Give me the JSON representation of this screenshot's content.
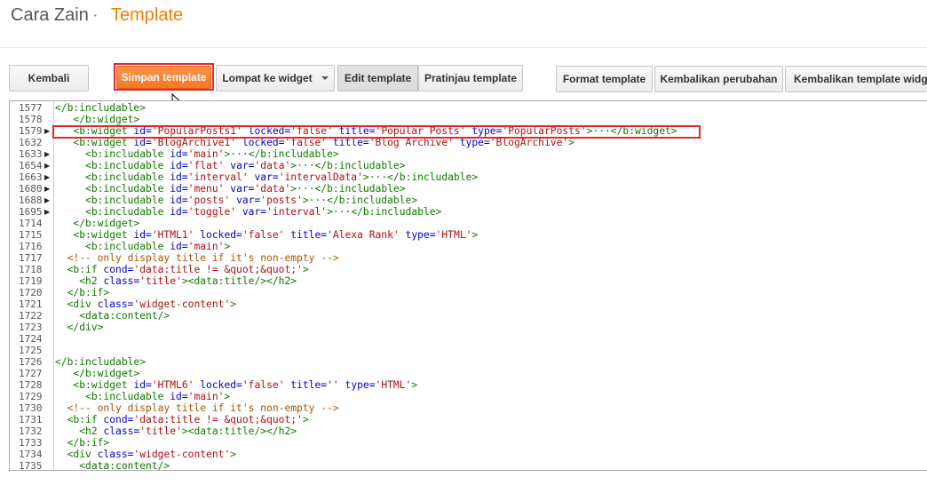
{
  "header": {
    "blog_name": "Cara Zain",
    "separator": "·",
    "page_title": "Template",
    "title_color": "#f57d00"
  },
  "toolbar": {
    "back": "Kembali",
    "save": "Simpan template",
    "jump_widget": "Lompat ke widget",
    "edit": "Edit template",
    "preview": "Pratinjau template",
    "format": "Format template",
    "revert": "Kembalikan perubahan",
    "revert_widgets": "Kembalikan template widget"
  },
  "editor": {
    "lines": [
      {
        "n": "1577",
        "fold": false,
        "tokens": [
          [
            "t",
            "</b:includable>"
          ]
        ]
      },
      {
        "n": "1578",
        "fold": false,
        "tokens": [
          [
            "p",
            "   "
          ],
          [
            "t",
            "</b:widget>"
          ]
        ]
      },
      {
        "n": "1579",
        "fold": true,
        "tokens": [
          [
            "p",
            "   "
          ],
          [
            "t",
            "<b:widget "
          ],
          [
            "a",
            "id="
          ],
          [
            "s",
            "'PopularPosts1'"
          ],
          [
            "p",
            " "
          ],
          [
            "a",
            "locked="
          ],
          [
            "s",
            "'false'"
          ],
          [
            "p",
            " "
          ],
          [
            "a",
            "title="
          ],
          [
            "s",
            "'Popular Posts'"
          ],
          [
            "p",
            " "
          ],
          [
            "a",
            "type="
          ],
          [
            "s",
            "'PopularPosts'"
          ],
          [
            "t",
            ">···</b:widget>"
          ]
        ]
      },
      {
        "n": "1632",
        "fold": false,
        "tokens": [
          [
            "p",
            "   "
          ],
          [
            "t",
            "<b:widget "
          ],
          [
            "a",
            "id="
          ],
          [
            "s",
            "'BlogArchive1'"
          ],
          [
            "p",
            " "
          ],
          [
            "a",
            "locked="
          ],
          [
            "s",
            "'false'"
          ],
          [
            "p",
            " "
          ],
          [
            "a",
            "title="
          ],
          [
            "s",
            "'Blog Archive'"
          ],
          [
            "p",
            " "
          ],
          [
            "a",
            "type="
          ],
          [
            "s",
            "'BlogArchive'"
          ],
          [
            "t",
            ">"
          ]
        ]
      },
      {
        "n": "1633",
        "fold": true,
        "tokens": [
          [
            "p",
            "     "
          ],
          [
            "t",
            "<b:includable "
          ],
          [
            "a",
            "id="
          ],
          [
            "s",
            "'main'"
          ],
          [
            "t",
            ">···</b:includable>"
          ]
        ]
      },
      {
        "n": "1654",
        "fold": true,
        "tokens": [
          [
            "p",
            "     "
          ],
          [
            "t",
            "<b:includable "
          ],
          [
            "a",
            "id="
          ],
          [
            "s",
            "'flat'"
          ],
          [
            "p",
            " "
          ],
          [
            "a",
            "var="
          ],
          [
            "s",
            "'data'"
          ],
          [
            "t",
            ">···</b:includable>"
          ]
        ]
      },
      {
        "n": "1663",
        "fold": true,
        "tokens": [
          [
            "p",
            "     "
          ],
          [
            "t",
            "<b:includable "
          ],
          [
            "a",
            "id="
          ],
          [
            "s",
            "'interval'"
          ],
          [
            "p",
            " "
          ],
          [
            "a",
            "var="
          ],
          [
            "s",
            "'intervalData'"
          ],
          [
            "t",
            ">···</b:includable>"
          ]
        ]
      },
      {
        "n": "1680",
        "fold": true,
        "tokens": [
          [
            "p",
            "     "
          ],
          [
            "t",
            "<b:includable "
          ],
          [
            "a",
            "id="
          ],
          [
            "s",
            "'menu'"
          ],
          [
            "p",
            " "
          ],
          [
            "a",
            "var="
          ],
          [
            "s",
            "'data'"
          ],
          [
            "t",
            ">···</b:includable>"
          ]
        ]
      },
      {
        "n": "1688",
        "fold": true,
        "tokens": [
          [
            "p",
            "     "
          ],
          [
            "t",
            "<b:includable "
          ],
          [
            "a",
            "id="
          ],
          [
            "s",
            "'posts'"
          ],
          [
            "p",
            " "
          ],
          [
            "a",
            "var="
          ],
          [
            "s",
            "'posts'"
          ],
          [
            "t",
            ">···</b:includable>"
          ]
        ]
      },
      {
        "n": "1695",
        "fold": true,
        "tokens": [
          [
            "p",
            "     "
          ],
          [
            "t",
            "<b:includable "
          ],
          [
            "a",
            "id="
          ],
          [
            "s",
            "'toggle'"
          ],
          [
            "p",
            " "
          ],
          [
            "a",
            "var="
          ],
          [
            "s",
            "'interval'"
          ],
          [
            "t",
            ">···</b:includable>"
          ]
        ]
      },
      {
        "n": "1714",
        "fold": false,
        "tokens": [
          [
            "p",
            "   "
          ],
          [
            "t",
            "</b:widget>"
          ]
        ]
      },
      {
        "n": "1715",
        "fold": false,
        "tokens": [
          [
            "p",
            "   "
          ],
          [
            "t",
            "<b:widget "
          ],
          [
            "a",
            "id="
          ],
          [
            "s",
            "'HTML1'"
          ],
          [
            "p",
            " "
          ],
          [
            "a",
            "locked="
          ],
          [
            "s",
            "'false'"
          ],
          [
            "p",
            " "
          ],
          [
            "a",
            "title="
          ],
          [
            "s",
            "'Alexa Rank'"
          ],
          [
            "p",
            " "
          ],
          [
            "a",
            "type="
          ],
          [
            "s",
            "'HTML'"
          ],
          [
            "t",
            ">"
          ]
        ]
      },
      {
        "n": "1716",
        "fold": false,
        "tokens": [
          [
            "p",
            "     "
          ],
          [
            "t",
            "<b:includable "
          ],
          [
            "a",
            "id="
          ],
          [
            "s",
            "'main'"
          ],
          [
            "t",
            ">"
          ]
        ]
      },
      {
        "n": "1717",
        "fold": false,
        "tokens": [
          [
            "p",
            "  "
          ],
          [
            "c",
            "<!-- only display title if it's non-empty -->"
          ]
        ]
      },
      {
        "n": "1718",
        "fold": false,
        "tokens": [
          [
            "p",
            "  "
          ],
          [
            "t",
            "<b:if "
          ],
          [
            "a",
            "cond="
          ],
          [
            "s",
            "'data:title != &quot;&quot;'"
          ],
          [
            "t",
            ">"
          ]
        ]
      },
      {
        "n": "1719",
        "fold": false,
        "tokens": [
          [
            "p",
            "    "
          ],
          [
            "t",
            "<h2 "
          ],
          [
            "a",
            "class="
          ],
          [
            "s",
            "'title'"
          ],
          [
            "t",
            "><data:title/></h2>"
          ]
        ]
      },
      {
        "n": "1720",
        "fold": false,
        "tokens": [
          [
            "p",
            "  "
          ],
          [
            "t",
            "</b:if>"
          ]
        ]
      },
      {
        "n": "1721",
        "fold": false,
        "tokens": [
          [
            "p",
            "  "
          ],
          [
            "t",
            "<div "
          ],
          [
            "a",
            "class="
          ],
          [
            "s",
            "'widget-content'"
          ],
          [
            "t",
            ">"
          ]
        ]
      },
      {
        "n": "1722",
        "fold": false,
        "tokens": [
          [
            "p",
            "    "
          ],
          [
            "t",
            "<data:content/>"
          ]
        ]
      },
      {
        "n": "1723",
        "fold": false,
        "tokens": [
          [
            "p",
            "  "
          ],
          [
            "t",
            "</div>"
          ]
        ]
      },
      {
        "n": "1724",
        "fold": false,
        "tokens": []
      },
      {
        "n": "1725",
        "fold": false,
        "tokens": []
      },
      {
        "n": "1726",
        "fold": false,
        "tokens": [
          [
            "t",
            "</b:includable>"
          ]
        ]
      },
      {
        "n": "1727",
        "fold": false,
        "tokens": [
          [
            "p",
            "   "
          ],
          [
            "t",
            "</b:widget>"
          ]
        ]
      },
      {
        "n": "1728",
        "fold": false,
        "tokens": [
          [
            "p",
            "   "
          ],
          [
            "t",
            "<b:widget "
          ],
          [
            "a",
            "id="
          ],
          [
            "s",
            "'HTML6'"
          ],
          [
            "p",
            " "
          ],
          [
            "a",
            "locked="
          ],
          [
            "s",
            "'false'"
          ],
          [
            "p",
            " "
          ],
          [
            "a",
            "title="
          ],
          [
            "s",
            "''"
          ],
          [
            "p",
            " "
          ],
          [
            "a",
            "type="
          ],
          [
            "s",
            "'HTML'"
          ],
          [
            "t",
            ">"
          ]
        ]
      },
      {
        "n": "1729",
        "fold": false,
        "tokens": [
          [
            "p",
            "     "
          ],
          [
            "t",
            "<b:includable "
          ],
          [
            "a",
            "id="
          ],
          [
            "s",
            "'main'"
          ],
          [
            "t",
            ">"
          ]
        ]
      },
      {
        "n": "1730",
        "fold": false,
        "tokens": [
          [
            "p",
            "  "
          ],
          [
            "c",
            "<!-- only display title if it's non-empty -->"
          ]
        ]
      },
      {
        "n": "1731",
        "fold": false,
        "tokens": [
          [
            "p",
            "  "
          ],
          [
            "t",
            "<b:if "
          ],
          [
            "a",
            "cond="
          ],
          [
            "s",
            "'data:title != &quot;&quot;'"
          ],
          [
            "t",
            ">"
          ]
        ]
      },
      {
        "n": "1732",
        "fold": false,
        "tokens": [
          [
            "p",
            "    "
          ],
          [
            "t",
            "<h2 "
          ],
          [
            "a",
            "class="
          ],
          [
            "s",
            "'title'"
          ],
          [
            "t",
            "><data:title/></h2>"
          ]
        ]
      },
      {
        "n": "1733",
        "fold": false,
        "tokens": [
          [
            "p",
            "  "
          ],
          [
            "t",
            "</b:if>"
          ]
        ]
      },
      {
        "n": "1734",
        "fold": false,
        "tokens": [
          [
            "p",
            "  "
          ],
          [
            "t",
            "<div "
          ],
          [
            "a",
            "class="
          ],
          [
            "s",
            "'widget-content'"
          ],
          [
            "t",
            ">"
          ]
        ]
      },
      {
        "n": "1735",
        "fold": false,
        "tokens": [
          [
            "p",
            "    "
          ],
          [
            "t",
            "<data:content/>"
          ]
        ]
      }
    ]
  }
}
